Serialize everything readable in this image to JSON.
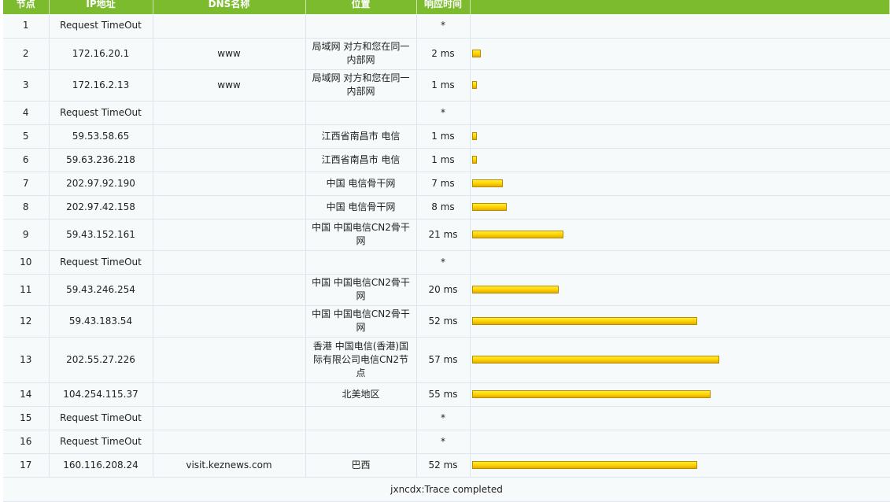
{
  "headers": {
    "hop": "节点",
    "ip": "IP地址",
    "dns": "DNS名称",
    "location": "位置",
    "time": "响应时间"
  },
  "rows": [
    {
      "hop": "1",
      "ip": "Request TimeOut",
      "dns": "",
      "location": "",
      "time": "*",
      "ms": null
    },
    {
      "hop": "2",
      "ip": "172.16.20.1",
      "dns": "www",
      "location": "局域网 对方和您在同一内部网",
      "time": "2 ms",
      "ms": 2
    },
    {
      "hop": "3",
      "ip": "172.16.2.13",
      "dns": "www",
      "location": "局域网 对方和您在同一内部网",
      "time": "1 ms",
      "ms": 1
    },
    {
      "hop": "4",
      "ip": "Request TimeOut",
      "dns": "",
      "location": "",
      "time": "*",
      "ms": null
    },
    {
      "hop": "5",
      "ip": "59.53.58.65",
      "dns": "",
      "location": "江西省南昌市 电信",
      "time": "1 ms",
      "ms": 1
    },
    {
      "hop": "6",
      "ip": "59.63.236.218",
      "dns": "",
      "location": "江西省南昌市 电信",
      "time": "1 ms",
      "ms": 1
    },
    {
      "hop": "7",
      "ip": "202.97.92.190",
      "dns": "",
      "location": "中国 电信骨干网",
      "time": "7 ms",
      "ms": 7
    },
    {
      "hop": "8",
      "ip": "202.97.42.158",
      "dns": "",
      "location": "中国 电信骨干网",
      "time": "8 ms",
      "ms": 8
    },
    {
      "hop": "9",
      "ip": "59.43.152.161",
      "dns": "",
      "location": "中国 中国电信CN2骨干网",
      "time": "21 ms",
      "ms": 21
    },
    {
      "hop": "10",
      "ip": "Request TimeOut",
      "dns": "",
      "location": "",
      "time": "*",
      "ms": null
    },
    {
      "hop": "11",
      "ip": "59.43.246.254",
      "dns": "",
      "location": "中国 中国电信CN2骨干网",
      "time": "20 ms",
      "ms": 20
    },
    {
      "hop": "12",
      "ip": "59.43.183.54",
      "dns": "",
      "location": "中国 中国电信CN2骨干网",
      "time": "52 ms",
      "ms": 52
    },
    {
      "hop": "13",
      "ip": "202.55.27.226",
      "dns": "",
      "location": "香港 中国电信(香港)国际有限公司电信CN2节点",
      "time": "57 ms",
      "ms": 57
    },
    {
      "hop": "14",
      "ip": "104.254.115.37",
      "dns": "",
      "location": "北美地区",
      "time": "55 ms",
      "ms": 55
    },
    {
      "hop": "15",
      "ip": "Request TimeOut",
      "dns": "",
      "location": "",
      "time": "*",
      "ms": null
    },
    {
      "hop": "16",
      "ip": "Request TimeOut",
      "dns": "",
      "location": "",
      "time": "*",
      "ms": null
    },
    {
      "hop": "17",
      "ip": "160.116.208.24",
      "dns": "visit.keznews.com",
      "location": "巴西",
      "time": "52 ms",
      "ms": 52
    }
  ],
  "footer": "jxncdx:Trace completed",
  "colors": {
    "header_bg": "#7cbb2d",
    "bar": "#ffd000"
  }
}
